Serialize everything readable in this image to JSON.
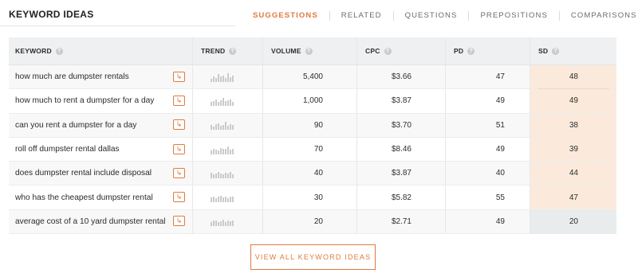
{
  "header": {
    "title": "KEYWORD IDEAS",
    "tabs": [
      {
        "label": "SUGGESTIONS",
        "active": true
      },
      {
        "label": "RELATED",
        "active": false
      },
      {
        "label": "QUESTIONS",
        "active": false
      },
      {
        "label": "PREPOSITIONS",
        "active": false
      },
      {
        "label": "COMPARISONS",
        "active": false
      }
    ]
  },
  "table": {
    "columns": {
      "keyword": "KEYWORD",
      "trend": "TREND",
      "volume": "VOLUME",
      "cpc": "CPC",
      "pd": "PD",
      "sd": "SD",
      "help_glyph": "?"
    },
    "go_glyph": "↳",
    "rows": [
      {
        "keyword": "how much are dumpster rentals",
        "volume": "5,400",
        "cpc": "$3.66",
        "pd": "47",
        "sd": "48",
        "sd_color": "orange",
        "trend": [
          0.35,
          0.6,
          0.45,
          0.8,
          0.55,
          0.7,
          0.4,
          0.9,
          0.5,
          0.65
        ]
      },
      {
        "keyword": "how much to rent a dumpster for a day",
        "volume": "1,000",
        "cpc": "$3.87",
        "pd": "49",
        "sd": "49",
        "sd_color": "orange",
        "trend": [
          0.4,
          0.5,
          0.7,
          0.45,
          0.6,
          0.8,
          0.5,
          0.6,
          0.7,
          0.45
        ]
      },
      {
        "keyword": "can you rent a dumpster for a day",
        "volume": "90",
        "cpc": "$3.70",
        "pd": "51",
        "sd": "38",
        "sd_color": "orange",
        "trend": [
          0.5,
          0.3,
          0.6,
          0.7,
          0.4,
          0.5,
          0.8,
          0.45,
          0.6,
          0.5
        ]
      },
      {
        "keyword": "roll off dumpster rental dallas",
        "volume": "70",
        "cpc": "$8.46",
        "pd": "49",
        "sd": "39",
        "sd_color": "orange",
        "trend": [
          0.45,
          0.6,
          0.5,
          0.4,
          0.7,
          0.55,
          0.6,
          0.8,
          0.5,
          0.6
        ]
      },
      {
        "keyword": "does dumpster rental include disposal",
        "volume": "40",
        "cpc": "$3.87",
        "pd": "40",
        "sd": "44",
        "sd_color": "orange",
        "trend": [
          0.6,
          0.4,
          0.5,
          0.7,
          0.5,
          0.45,
          0.6,
          0.5,
          0.7,
          0.4
        ]
      },
      {
        "keyword": "who has the cheapest dumpster rental",
        "volume": "30",
        "cpc": "$5.82",
        "pd": "55",
        "sd": "47",
        "sd_color": "orange",
        "trend": [
          0.5,
          0.6,
          0.45,
          0.55,
          0.7,
          0.5,
          0.6,
          0.4,
          0.55,
          0.6
        ]
      },
      {
        "keyword": "average cost of a 10 yard dumpster rental",
        "volume": "20",
        "cpc": "$2.71",
        "pd": "49",
        "sd": "20",
        "sd_color": "grey",
        "trend": [
          0.4,
          0.55,
          0.6,
          0.45,
          0.5,
          0.7,
          0.45,
          0.6,
          0.5,
          0.55
        ]
      }
    ]
  },
  "footer": {
    "view_all_label": "VIEW ALL KEYWORD IDEAS"
  },
  "colors": {
    "accent": "#e07a3f",
    "sd_orange": "#fbeadb",
    "sd_grey": "#e9ecec"
  }
}
